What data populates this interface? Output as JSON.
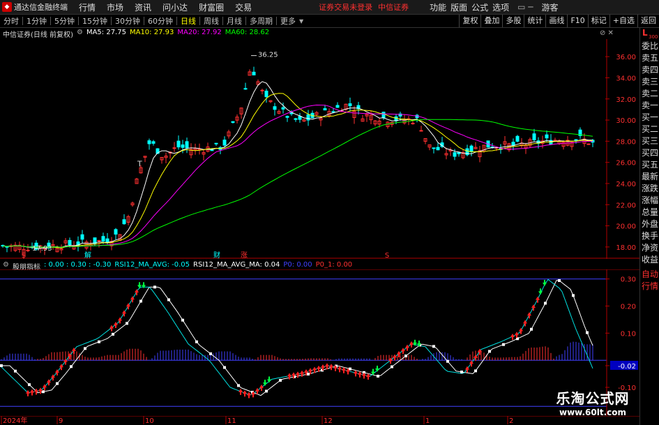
{
  "menubar": {
    "app_title": "通达信金融终端",
    "logo": "tdx-logo",
    "items": [
      "行情",
      "市场",
      "资讯",
      "问小达",
      "财富圈",
      "交易"
    ],
    "warning": "证券交易未登录",
    "broker": "中信证券",
    "right_items": [
      "功能",
      "版面",
      "公式",
      "选项"
    ],
    "guest": "游客"
  },
  "periodbar": {
    "items": [
      "分时",
      "1分钟",
      "5分钟",
      "15分钟",
      "30分钟",
      "60分钟",
      "日线",
      "周线",
      "月线",
      "多周期"
    ],
    "active": "日线",
    "more": "更多",
    "tools": [
      "复权",
      "叠加",
      "多股",
      "统计",
      "画线",
      "F10",
      "标记",
      "+自选",
      "返回"
    ]
  },
  "main_chart": {
    "stock": "中信证券(日线 前复权)",
    "ma5": "MA5: 27.75",
    "ma10": "MA10: 27.93",
    "ma20": "MA20: 27.92",
    "ma60": "MA60: 28.62",
    "high_label": "36.25",
    "low_label": "17.93",
    "t_marker": "T",
    "event_labels": [
      "S",
      "解",
      "财",
      "涨",
      "S"
    ],
    "y_ticks": [
      "36.00",
      "34.00",
      "32.00",
      "30.00",
      "28.00",
      "26.00",
      "24.00",
      "22.00",
      "20.00",
      "18.00"
    ],
    "colors": {
      "ma5": "#ffffff",
      "ma10": "#ffff00",
      "ma20": "#ff00ff",
      "ma60": "#00ff00",
      "up": "#ff3030",
      "down": "#00ffff"
    }
  },
  "sub_chart": {
    "name": "股朋指标",
    "values": ": 0.00 : 0.30 : -0.30",
    "rsi_avg": "RSI12_MA_AVG: -0.05",
    "rsi_avg_ma": "RSI12_MA_AVG_MA: 0.04",
    "p0": "P0: 0.00",
    "p0_1": "P0_1: 0.00",
    "y_ticks": [
      "0.30",
      "0.20",
      "0.10",
      "-0.02",
      "-0.10"
    ],
    "current_label": "-0.02"
  },
  "x_axis": [
    "2024年",
    "9",
    "10",
    "11",
    "12",
    "1",
    "2"
  ],
  "right_panel": [
    "委比",
    "卖五",
    "卖四",
    "卖三",
    "卖二",
    "卖一",
    "买一",
    "买二",
    "买三",
    "买四",
    "买五",
    "最新",
    "涨跌",
    "涨幅",
    "总量",
    "外盘",
    "换手",
    "净资",
    "收益",
    "自动",
    "行情"
  ],
  "right_badge": "L",
  "right_badge_num": "300",
  "watermark": {
    "title": "乐淘公式网",
    "url": "www.60lt.com"
  }
}
